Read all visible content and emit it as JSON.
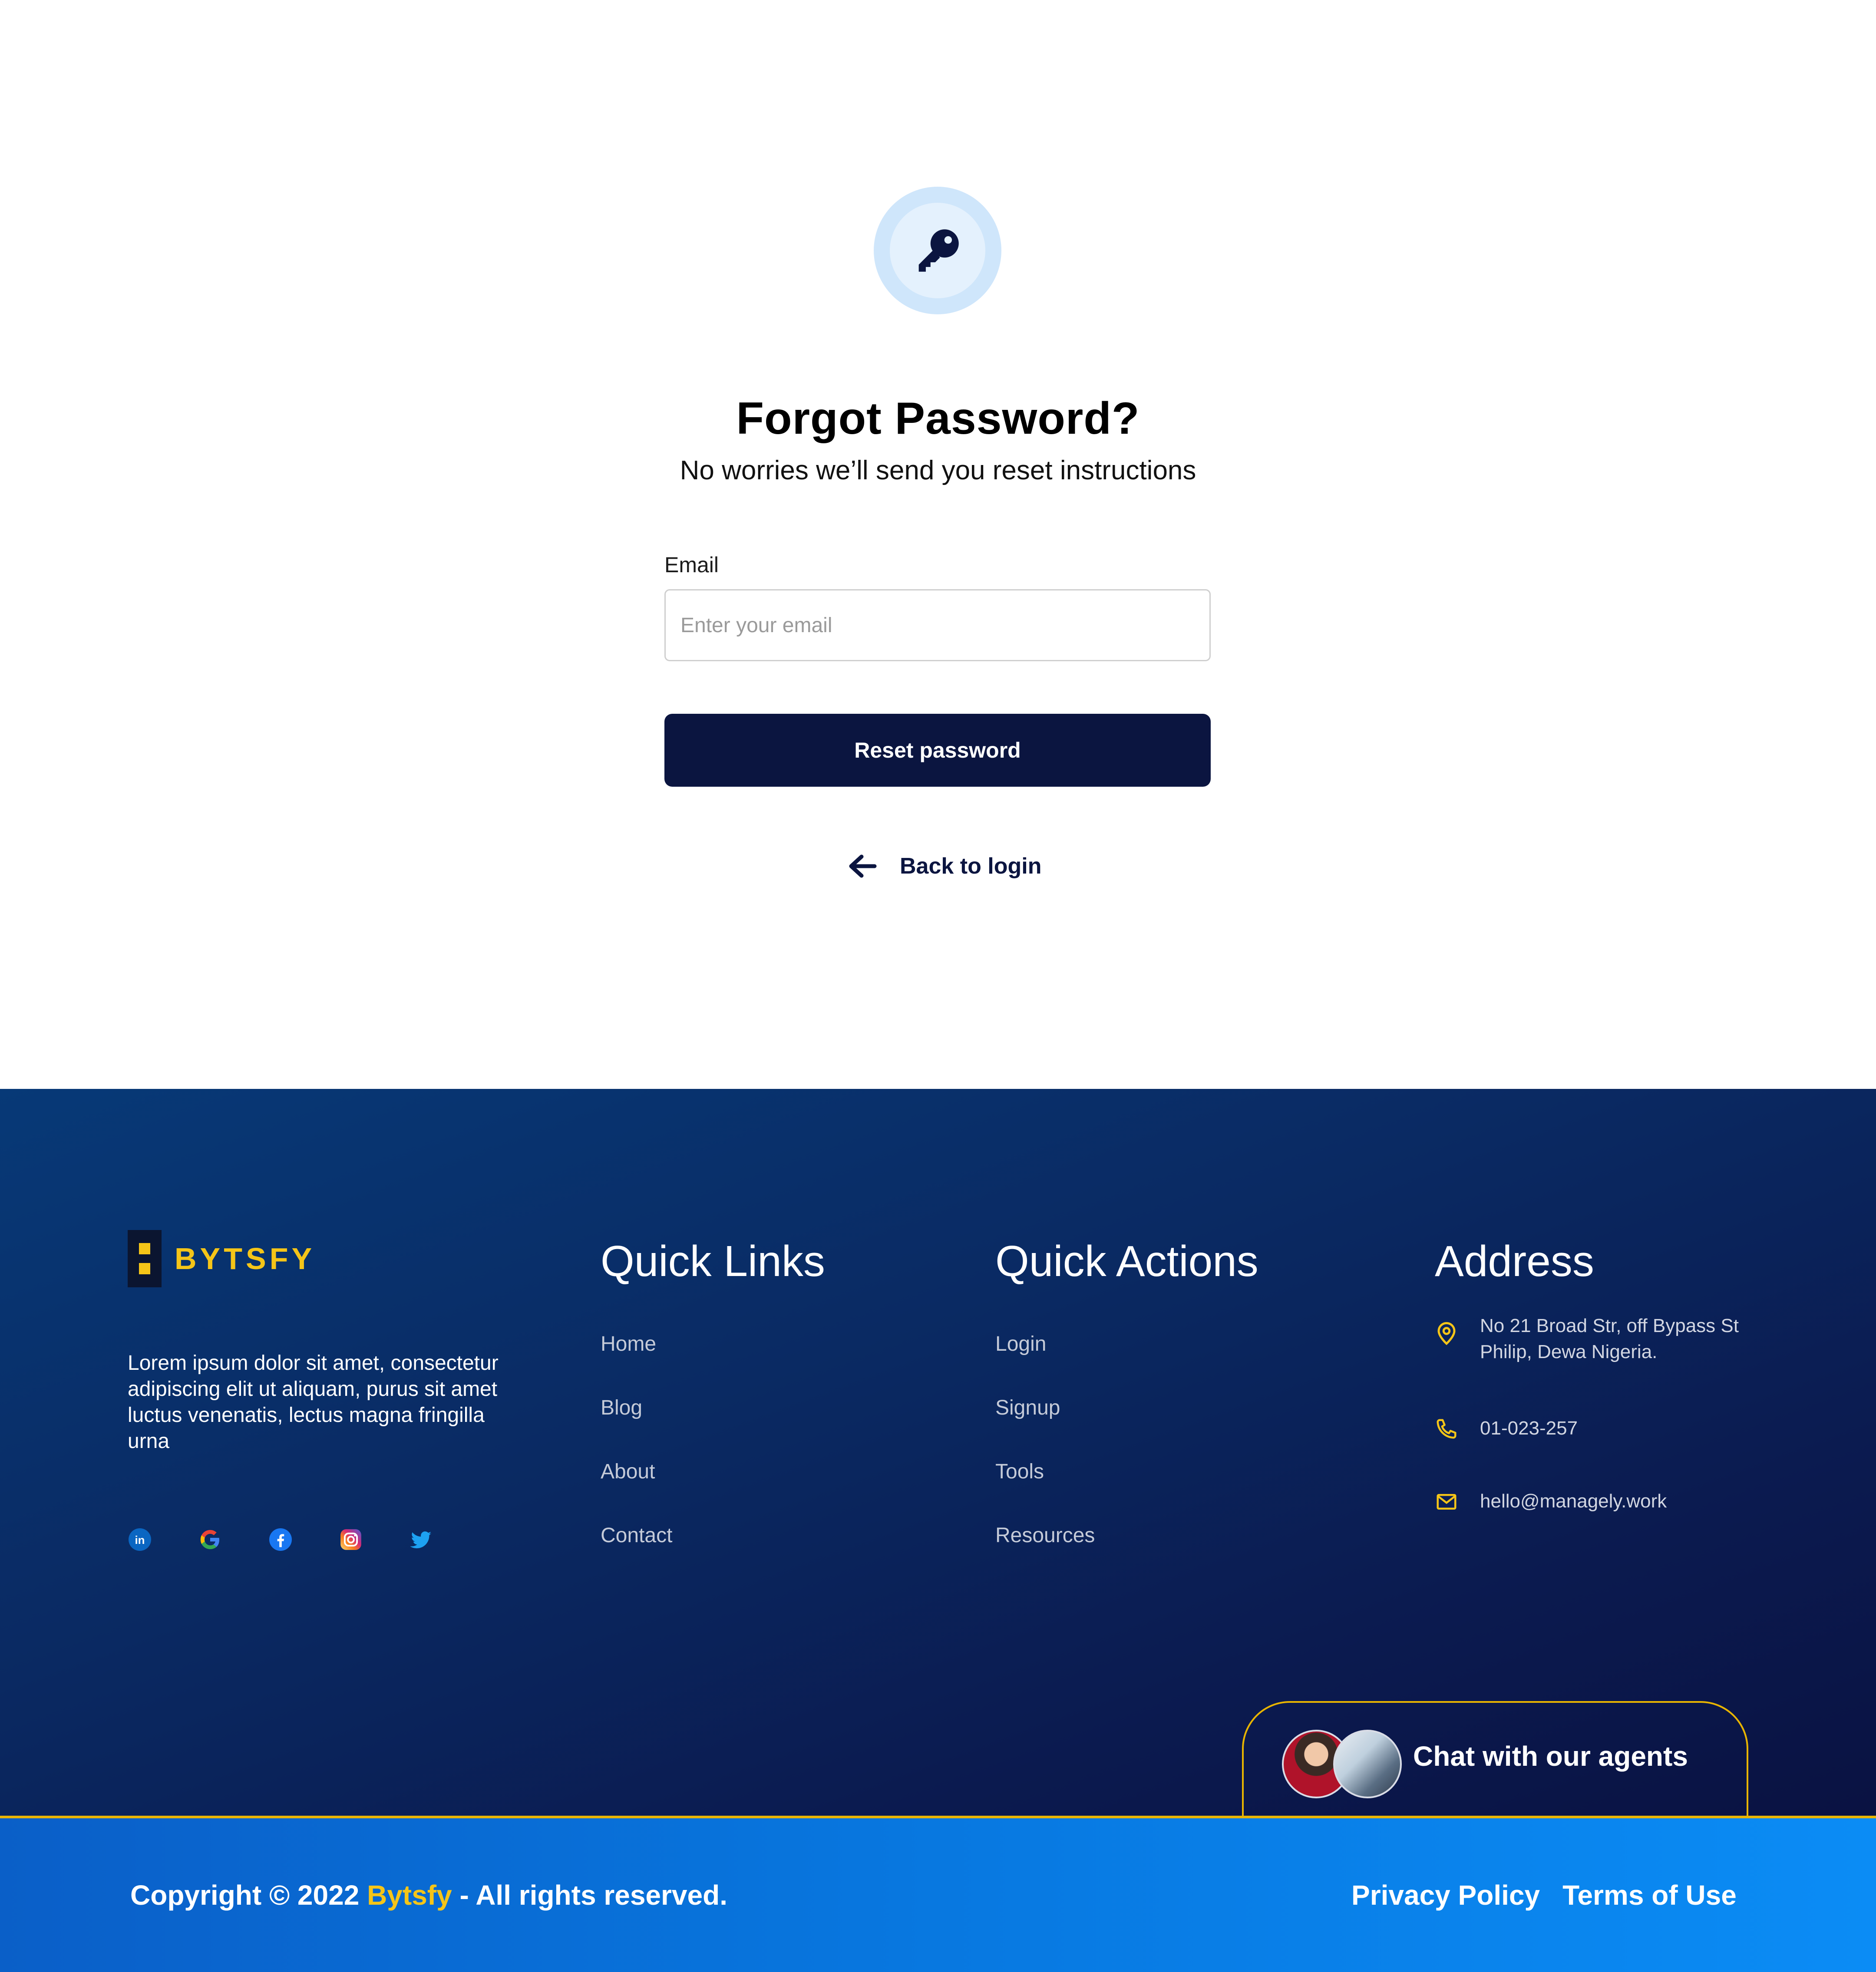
{
  "reset": {
    "title": "Forgot Password?",
    "subtitle": "No worries we’ll send you reset instructions",
    "email_label": "Email",
    "email_placeholder": "Enter your email",
    "email_value": "",
    "submit_label": "Reset password",
    "back_label": "Back to login"
  },
  "footer": {
    "brand_name": "BYTSFY",
    "description": "Lorem ipsum dolor sit amet, consectetur adipiscing elit ut aliquam, purus sit amet luctus venenatis, lectus magna fringilla urna",
    "socials": [
      "linkedin-icon",
      "google-icon",
      "facebook-icon",
      "instagram-icon",
      "twitter-icon"
    ],
    "quick_links": {
      "title": "Quick Links",
      "items": [
        "Home",
        "Blog",
        "About",
        "Contact"
      ]
    },
    "quick_actions": {
      "title": "Quick Actions",
      "items": [
        "Login",
        "Signup",
        "Tools",
        "Resources"
      ]
    },
    "address": {
      "title": "Address",
      "street_line1": "No 21 Broad Str, off Bypass St",
      "street_line2": "Philip, Dewa Nigeria.",
      "phone": "01-023-257",
      "email": "hello@managely.work"
    },
    "chat": {
      "label": "Chat with our agents"
    }
  },
  "bottom_bar": {
    "copyright_prefix": "Copyright © 2022 ",
    "copyright_brand": "Bytsfy",
    "copyright_suffix": " - All rights reserved.",
    "privacy": "Privacy Policy",
    "terms": "Terms of Use"
  },
  "colors": {
    "primary_navy": "#0b1540",
    "accent_yellow": "#f5c518",
    "footer_gradient_start": "#073977",
    "footer_gradient_end": "#0a1242",
    "bottom_bar_blue": "#0878e0"
  }
}
